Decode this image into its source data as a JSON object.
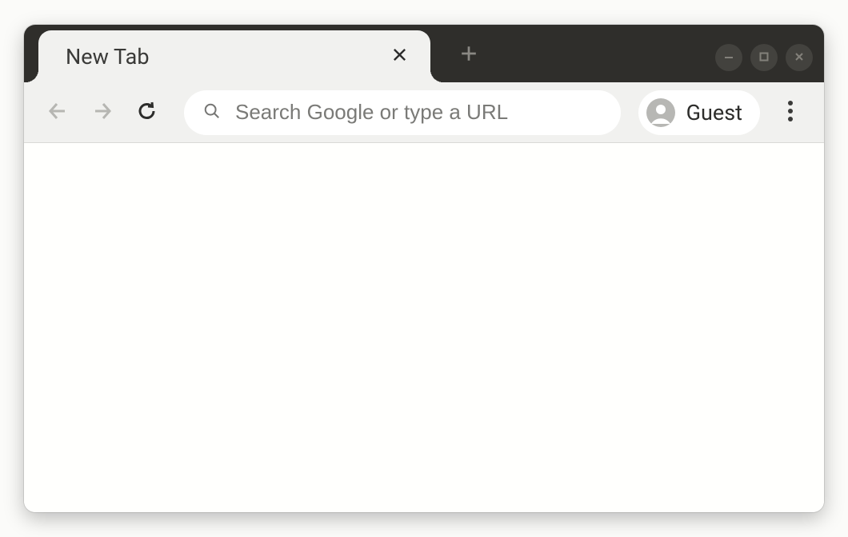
{
  "tab": {
    "title": "New Tab"
  },
  "toolbar": {
    "omnibox_placeholder": "Search Google or type a URL",
    "profile_label": "Guest"
  }
}
